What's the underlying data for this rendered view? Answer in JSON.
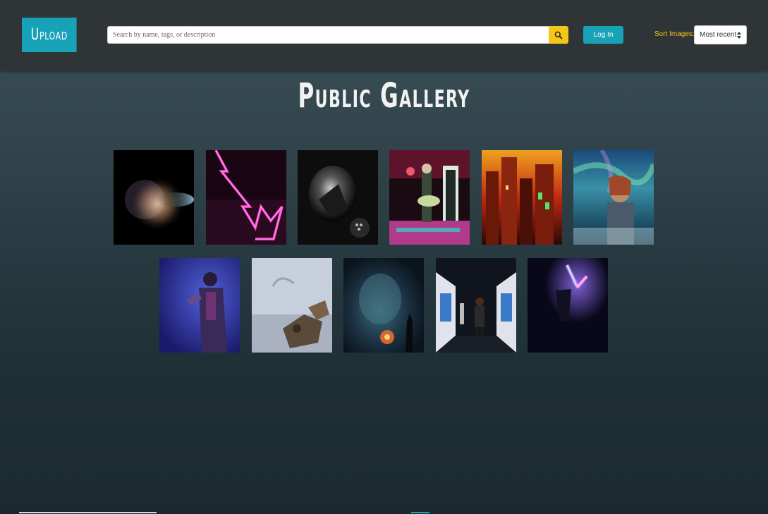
{
  "header": {
    "upload_label": "Upload",
    "search": {
      "placeholder": "Search by name, tags, or description",
      "value": ""
    },
    "search_icon": "search-icon",
    "login_label": "Log In",
    "sort": {
      "label": "Sort Images:",
      "selected": "Most recent"
    }
  },
  "gallery": {
    "title": "Public Gallery"
  },
  "colors": {
    "accent": "#17a2b8",
    "highlight": "#f5c518",
    "topbar": "#2f3436"
  }
}
